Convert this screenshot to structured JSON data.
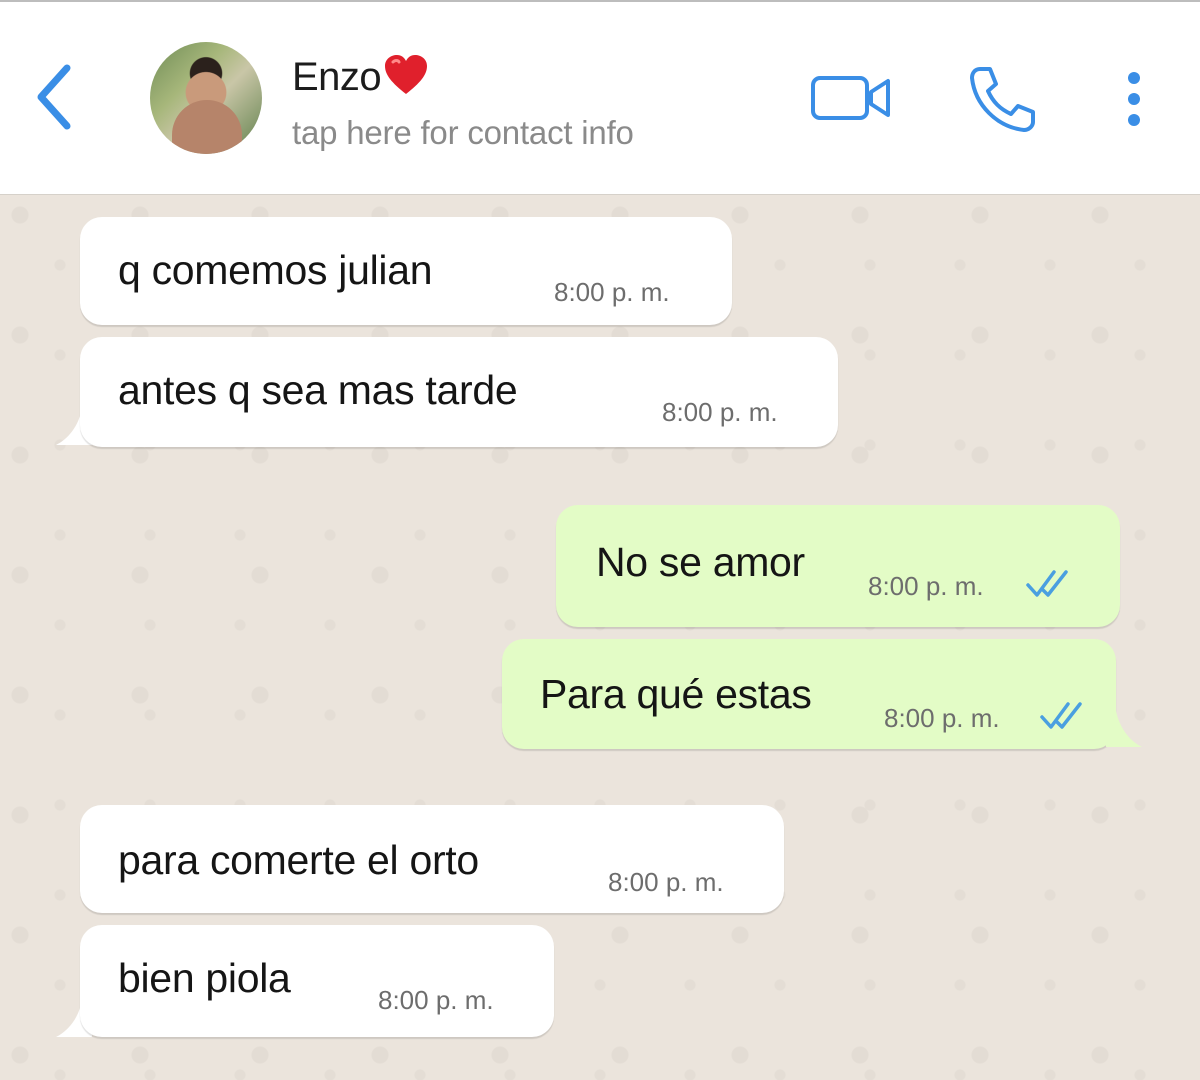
{
  "header": {
    "contact_name": "Enzo",
    "contact_subtitle": "tap here for contact info",
    "icons": [
      "chevron-left-icon",
      "avatar",
      "heart-icon",
      "video-camera-icon",
      "phone-icon",
      "more-vertical-icon"
    ],
    "accent_color": "#3a8ee6"
  },
  "messages": [
    {
      "direction": "incoming",
      "text": "q comemos julian",
      "time": "8:00 p. m."
    },
    {
      "direction": "incoming",
      "text": "antes q sea mas tarde",
      "time": "8:00 p. m."
    },
    {
      "direction": "outgoing",
      "text": "No se amor",
      "time": "8:00 p. m.",
      "status": "read"
    },
    {
      "direction": "outgoing",
      "text": "Para qué estas",
      "time": "8:00 p. m.",
      "status": "read"
    },
    {
      "direction": "incoming",
      "text": "para comerte el orto",
      "time": "8:00 p. m."
    },
    {
      "direction": "incoming",
      "text": "bien piola",
      "time": "8:00 p. m."
    }
  ],
  "colors": {
    "incoming_bubble": "#ffffff",
    "outgoing_bubble": "#e3fcc6",
    "chat_background": "#ebe4dc",
    "read_ticks": "#4a9fe0"
  }
}
